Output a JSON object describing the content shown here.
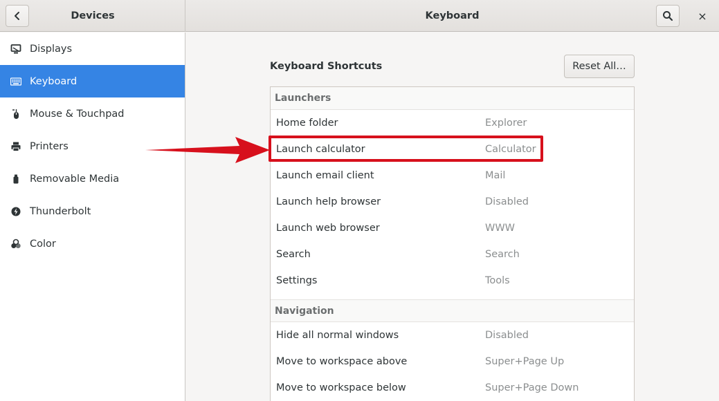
{
  "header": {
    "left_title": "Devices",
    "main_title": "Keyboard",
    "back_icon": "chevron-left-icon",
    "search_icon": "search-icon",
    "close_label": "×"
  },
  "sidebar": {
    "items": [
      {
        "label": "Displays",
        "icon": "display-icon",
        "active": false
      },
      {
        "label": "Keyboard",
        "icon": "keyboard-icon",
        "active": true
      },
      {
        "label": "Mouse & Touchpad",
        "icon": "mouse-icon",
        "active": false
      },
      {
        "label": "Printers",
        "icon": "printer-icon",
        "active": false
      },
      {
        "label": "Removable Media",
        "icon": "usb-media-icon",
        "active": false
      },
      {
        "label": "Thunderbolt",
        "icon": "thunderbolt-icon",
        "active": false
      },
      {
        "label": "Color",
        "icon": "color-icon",
        "active": false
      }
    ]
  },
  "main": {
    "section_title": "Keyboard Shortcuts",
    "reset_button": "Reset All…",
    "groups": [
      {
        "title": "Launchers",
        "rows": [
          {
            "name": "Home folder",
            "accel": "Explorer"
          },
          {
            "name": "Launch calculator",
            "accel": "Calculator"
          },
          {
            "name": "Launch email client",
            "accel": "Mail"
          },
          {
            "name": "Launch help browser",
            "accel": "Disabled"
          },
          {
            "name": "Launch web browser",
            "accel": "WWW"
          },
          {
            "name": "Search",
            "accel": "Search"
          },
          {
            "name": "Settings",
            "accel": "Tools"
          }
        ]
      },
      {
        "title": "Navigation",
        "rows": [
          {
            "name": "Hide all normal windows",
            "accel": "Disabled"
          },
          {
            "name": "Move to workspace above",
            "accel": "Super+Page Up"
          },
          {
            "name": "Move to workspace below",
            "accel": "Super+Page Down"
          }
        ]
      }
    ]
  },
  "colors": {
    "accent": "#3584e4",
    "annotation": "#d7101c"
  }
}
